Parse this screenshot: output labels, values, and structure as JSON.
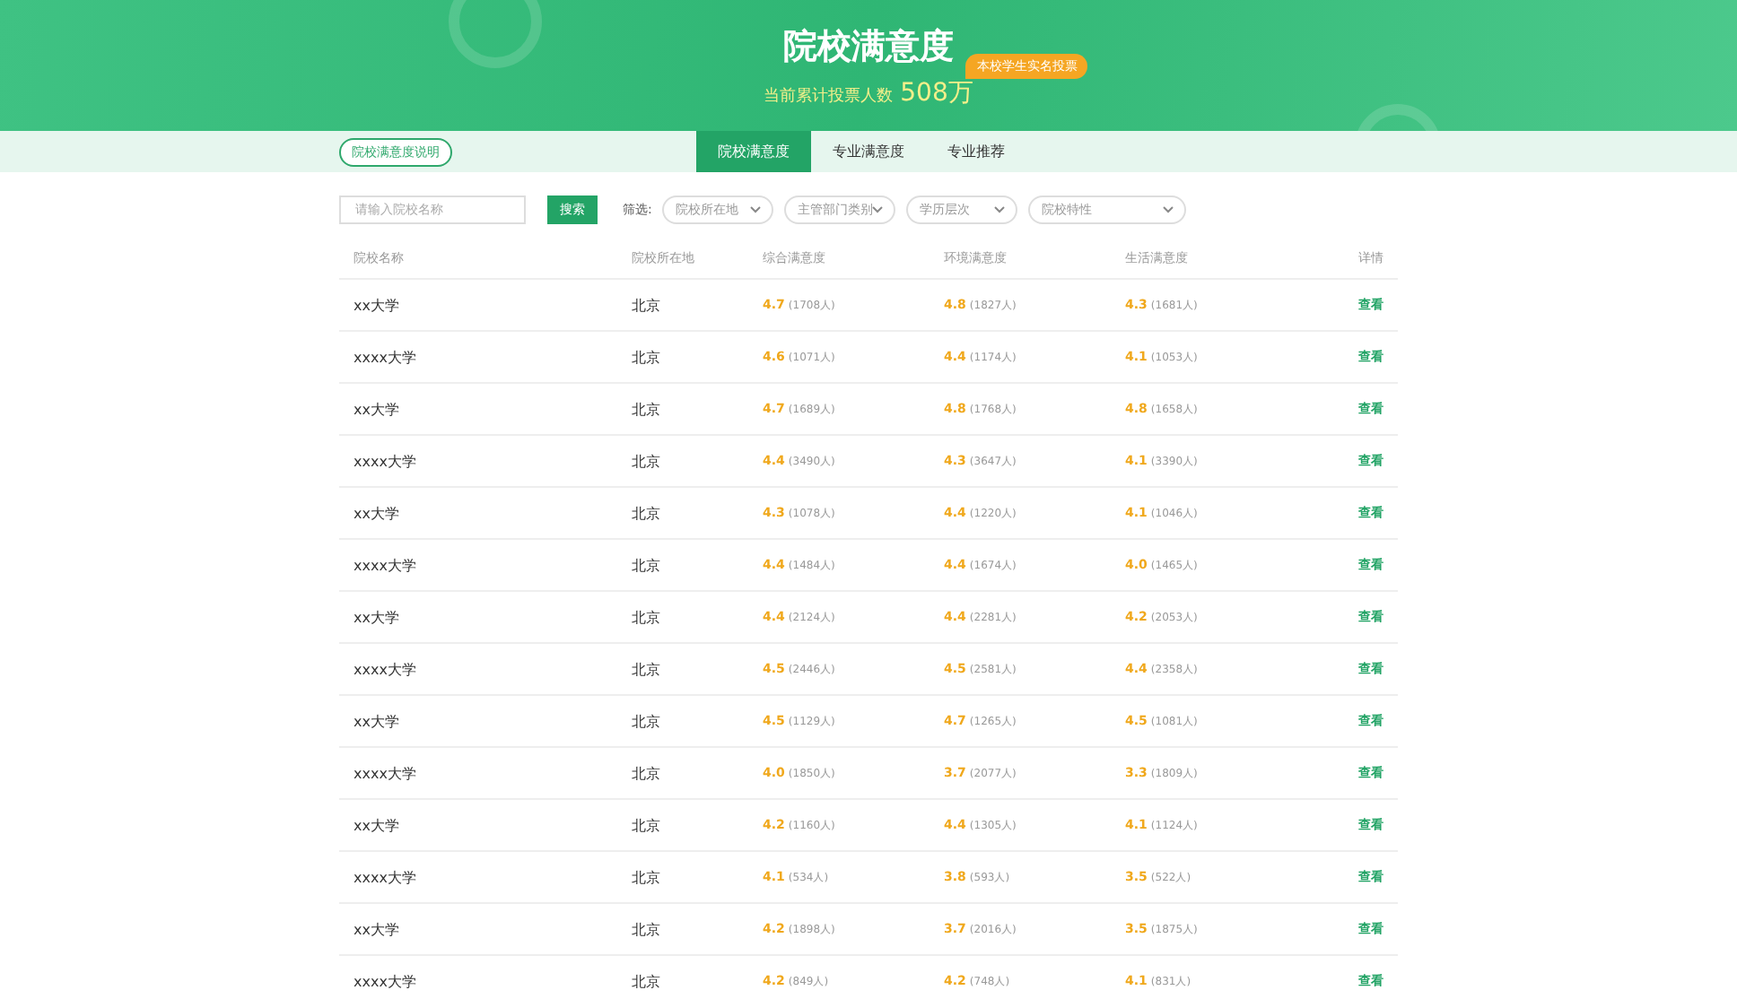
{
  "header": {
    "title": "院校满意度",
    "vote_label": "当前累计投票人数",
    "vote_count": "508万",
    "badge": "本校学生实名投票"
  },
  "explain_link": "院校满意度说明",
  "tabs": [
    {
      "label": "院校满意度",
      "selected": true
    },
    {
      "label": "专业满意度",
      "selected": false
    },
    {
      "label": "专业推荐",
      "selected": false
    }
  ],
  "search": {
    "placeholder": "请输入院校名称",
    "button": "搜索"
  },
  "filter": {
    "label": "筛选:",
    "selects": [
      "院校所在地",
      "主管部门类别",
      "学历层次",
      "院校特性"
    ]
  },
  "table": {
    "columns": [
      "院校名称",
      "院校所在地",
      "综合满意度",
      "环境满意度",
      "生活满意度",
      "详情"
    ],
    "rows": [
      {
        "name": "xx大学",
        "location": "北京",
        "overall": [
          "4.7",
          "(1708人)"
        ],
        "environment": [
          "4.8",
          "(1827人)"
        ],
        "life": [
          "4.3",
          "(1681人)"
        ],
        "action": "查看"
      },
      {
        "name": "xxxx大学",
        "location": "北京",
        "overall": [
          "4.6",
          "(1071人)"
        ],
        "environment": [
          "4.4",
          "(1174人)"
        ],
        "life": [
          "4.1",
          "(1053人)"
        ],
        "action": "查看"
      },
      {
        "name": "xx大学",
        "location": "北京",
        "overall": [
          "4.7",
          "(1689人)"
        ],
        "environment": [
          "4.8",
          "(1768人)"
        ],
        "life": [
          "4.8",
          "(1658人)"
        ],
        "action": "查看"
      },
      {
        "name": "xxxx大学",
        "location": "北京",
        "overall": [
          "4.4",
          "(3490人)"
        ],
        "environment": [
          "4.3",
          "(3647人)"
        ],
        "life": [
          "4.1",
          "(3390人)"
        ],
        "action": "查看"
      },
      {
        "name": "xx大学",
        "location": "北京",
        "overall": [
          "4.3",
          "(1078人)"
        ],
        "environment": [
          "4.4",
          "(1220人)"
        ],
        "life": [
          "4.1",
          "(1046人)"
        ],
        "action": "查看"
      },
      {
        "name": "xxxx大学",
        "location": "北京",
        "overall": [
          "4.4",
          "(1484人)"
        ],
        "environment": [
          "4.4",
          "(1674人)"
        ],
        "life": [
          "4.0",
          "(1465人)"
        ],
        "action": "查看"
      },
      {
        "name": "xx大学",
        "location": "北京",
        "overall": [
          "4.4",
          "(2124人)"
        ],
        "environment": [
          "4.4",
          "(2281人)"
        ],
        "life": [
          "4.2",
          "(2053人)"
        ],
        "action": "查看"
      },
      {
        "name": "xxxx大学",
        "location": "北京",
        "overall": [
          "4.5",
          "(2446人)"
        ],
        "environment": [
          "4.5",
          "(2581人)"
        ],
        "life": [
          "4.4",
          "(2358人)"
        ],
        "action": "查看"
      },
      {
        "name": "xx大学",
        "location": "北京",
        "overall": [
          "4.5",
          "(1129人)"
        ],
        "environment": [
          "4.7",
          "(1265人)"
        ],
        "life": [
          "4.5",
          "(1081人)"
        ],
        "action": "查看"
      },
      {
        "name": "xxxx大学",
        "location": "北京",
        "overall": [
          "4.0",
          "(1850人)"
        ],
        "environment": [
          "3.7",
          "(2077人)"
        ],
        "life": [
          "3.3",
          "(1809人)"
        ],
        "action": "查看"
      },
      {
        "name": "xx大学",
        "location": "北京",
        "overall": [
          "4.2",
          "(1160人)"
        ],
        "environment": [
          "4.4",
          "(1305人)"
        ],
        "life": [
          "4.1",
          "(1124人)"
        ],
        "action": "查看"
      },
      {
        "name": "xxxx大学",
        "location": "北京",
        "overall": [
          "4.1",
          "(534人)"
        ],
        "environment": [
          "3.8",
          "(593人)"
        ],
        "life": [
          "3.5",
          "(522人)"
        ],
        "action": "查看"
      },
      {
        "name": "xx大学",
        "location": "北京",
        "overall": [
          "4.2",
          "(1898人)"
        ],
        "environment": [
          "3.7",
          "(2016人)"
        ],
        "life": [
          "3.5",
          "(1875人)"
        ],
        "action": "查看"
      },
      {
        "name": "xxxx大学",
        "location": "北京",
        "overall": [
          "4.2",
          "(849人)"
        ],
        "environment": [
          "4.2",
          "(748人)"
        ],
        "life": [
          "4.1",
          "(831人)"
        ],
        "action": "查看"
      }
    ]
  }
}
